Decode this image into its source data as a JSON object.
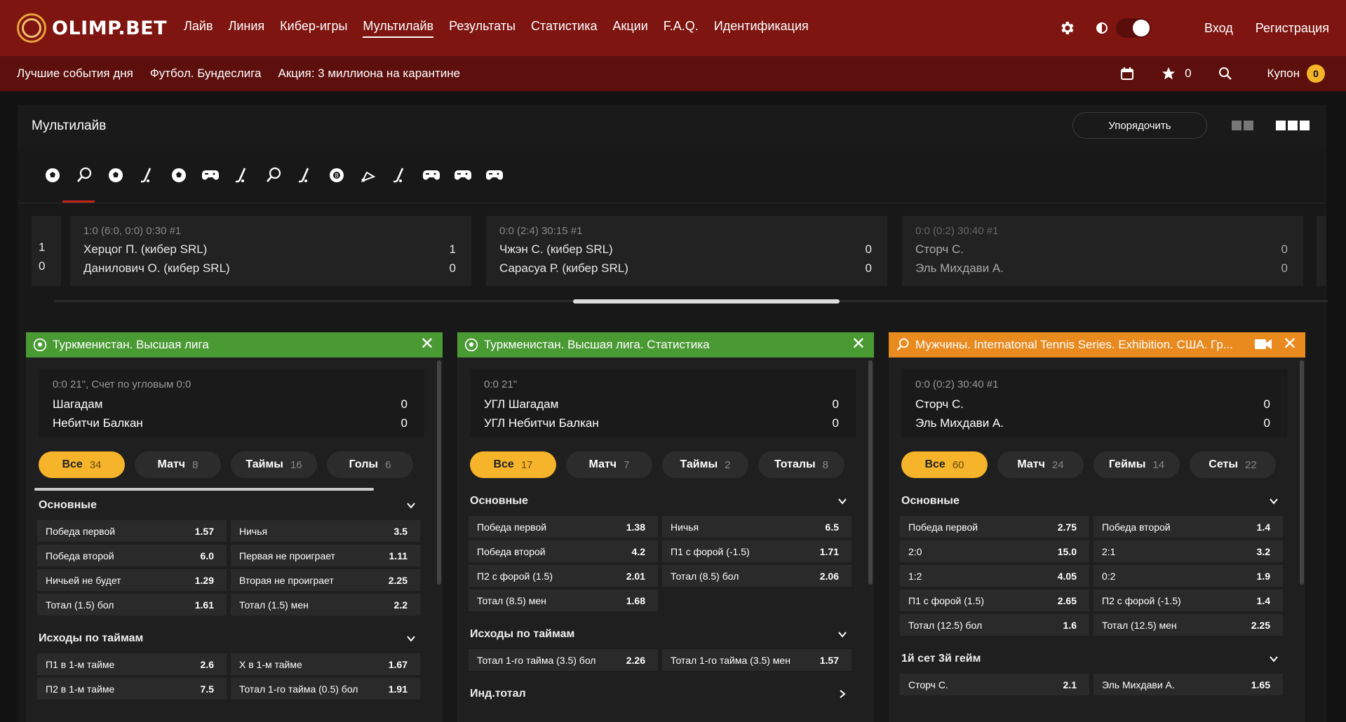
{
  "brand": {
    "name": "OLIMP.BET"
  },
  "nav": [
    "Лайв",
    "Линия",
    "Кибер-игры",
    "Мультилайв",
    "Результаты",
    "Статистика",
    "Акции",
    "F.A.Q.",
    "Идентификация"
  ],
  "header_right": {
    "login": "Вход",
    "register": "Регистрация"
  },
  "subnav": [
    "Лучшие события дня",
    "Футбол. Бундеслига",
    "Акция: 3 миллиона на карантине"
  ],
  "sub_right": {
    "favorites_count": "0",
    "coupon_label": "Купон",
    "coupon_count": "0"
  },
  "page": {
    "title": "Мультилайв",
    "order_button": "Упорядочить"
  },
  "sports_icons": [
    "football-icon",
    "tennis-icon",
    "basketball-icon",
    "hockey-icon",
    "volleyball-icon",
    "esports-icon",
    "cricket-icon",
    "table-tennis-icon",
    "hockey-stick-icon",
    "billiards-icon",
    "badminton-icon",
    "bandy-icon",
    "gamepad-icon",
    "gamepad-icon",
    "gamepad-icon"
  ],
  "live_strip": [
    {
      "meta": "",
      "team1": "",
      "team2": "",
      "score1": "1",
      "score2": "0"
    },
    {
      "meta": "1:0 (6:0, 0:0) 0:30 #1",
      "team1": "Херцог П. (кибер SRL)",
      "team2": "Данилович О. (кибер SRL)",
      "score1": "1",
      "score2": "0"
    },
    {
      "meta": "0:0 (2:4) 30:15 #1",
      "team1": "Чжэн С. (кибер SRL)",
      "team2": "Сарасуа Р. (кибер SRL)",
      "score1": "0",
      "score2": "0"
    },
    {
      "meta": "0:0 (0:2) 30:40 #1",
      "team1": "Сторч С.",
      "team2": "Эль Михдави А.",
      "score1": "0",
      "score2": "0"
    }
  ],
  "widgets": [
    {
      "title": "Туркменистан. Высшая лига",
      "meta": "0:0 21\", Счет по угловым 0:0",
      "team1": "Шагадам",
      "team2": "Небитчи Балкан",
      "score1": "0",
      "score2": "0",
      "tabs": [
        {
          "label": "Все",
          "count": "34"
        },
        {
          "label": "Матч",
          "count": "8"
        },
        {
          "label": "Таймы",
          "count": "16"
        },
        {
          "label": "Голы",
          "count": "6"
        }
      ],
      "sections": [
        {
          "title": "Основные",
          "rows": [
            [
              {
                "l": "Победа первой",
                "v": "1.57"
              },
              {
                "l": "Ничья",
                "v": "3.5"
              }
            ],
            [
              {
                "l": "Победа второй",
                "v": "6.0"
              },
              {
                "l": "Первая не проиграет",
                "v": "1.11"
              }
            ],
            [
              {
                "l": "Ничьей не будет",
                "v": "1.29"
              },
              {
                "l": "Вторая не проиграет",
                "v": "2.25"
              }
            ],
            [
              {
                "l": "Тотал (1.5) бол",
                "v": "1.61"
              },
              {
                "l": "Тотал (1.5) мен",
                "v": "2.2"
              }
            ]
          ]
        },
        {
          "title": "Исходы по таймам",
          "rows": [
            [
              {
                "l": "П1 в 1-м тайме",
                "v": "2.6"
              },
              {
                "l": "Х в 1-м тайме",
                "v": "1.67"
              }
            ],
            [
              {
                "l": "П2 в 1-м тайме",
                "v": "7.5"
              },
              {
                "l": "Тотал 1-го тайма (0.5) бол",
                "v": "1.91"
              }
            ]
          ]
        }
      ]
    },
    {
      "title": "Туркменистан. Высшая лига. Статистика",
      "meta": "0:0 21\"",
      "team1": "УГЛ Шагадам",
      "team2": "УГЛ Небитчи Балкан",
      "score1": "0",
      "score2": "0",
      "tabs": [
        {
          "label": "Все",
          "count": "17"
        },
        {
          "label": "Матч",
          "count": "7"
        },
        {
          "label": "Таймы",
          "count": "2"
        },
        {
          "label": "Тоталы",
          "count": "8"
        }
      ],
      "sections": [
        {
          "title": "Основные",
          "rows": [
            [
              {
                "l": "Победа первой",
                "v": "1.38"
              },
              {
                "l": "Ничья",
                "v": "6.5"
              }
            ],
            [
              {
                "l": "Победа второй",
                "v": "4.2"
              },
              {
                "l": "П1 с форой (-1.5)",
                "v": "1.71"
              }
            ],
            [
              {
                "l": "П2 с форой (1.5)",
                "v": "2.01"
              },
              {
                "l": "Тотал (8.5) бол",
                "v": "2.06"
              }
            ],
            [
              {
                "l": "Тотал (8.5) мен",
                "v": "1.68"
              },
              null
            ]
          ]
        },
        {
          "title": "Исходы по таймам",
          "rows": [
            [
              {
                "l": "Тотал 1-го тайма (3.5) бол",
                "v": "2.26"
              },
              {
                "l": "Тотал 1-го тайма (3.5) мен",
                "v": "1.57"
              }
            ]
          ]
        },
        {
          "title": "Инд.тотал",
          "rows": []
        }
      ]
    },
    {
      "title": "Мужчины. Internatonal Tennis Series. Exhibition. США. Гр...",
      "meta": "0:0 (0:2) 30:40 #1",
      "team1": "Сторч С.",
      "team2": "Эль Михдави А.",
      "score1": "0",
      "score2": "0",
      "tabs": [
        {
          "label": "Все",
          "count": "60"
        },
        {
          "label": "Матч",
          "count": "24"
        },
        {
          "label": "Геймы",
          "count": "14"
        },
        {
          "label": "Сеты",
          "count": "22"
        }
      ],
      "sections": [
        {
          "title": "Основные",
          "rows": [
            [
              {
                "l": "Победа первой",
                "v": "2.75"
              },
              {
                "l": "Победа второй",
                "v": "1.4"
              }
            ],
            [
              {
                "l": "2:0",
                "v": "15.0"
              },
              {
                "l": "2:1",
                "v": "3.2"
              }
            ],
            [
              {
                "l": "1:2",
                "v": "4.05"
              },
              {
                "l": "0:2",
                "v": "1.9"
              }
            ],
            [
              {
                "l": "П1 с форой (1.5)",
                "v": "2.65"
              },
              {
                "l": "П2 с форой (-1.5)",
                "v": "1.4"
              }
            ],
            [
              {
                "l": "Тотал (12.5) бол",
                "v": "1.6"
              },
              {
                "l": "Тотал (12.5) мен",
                "v": "2.25"
              }
            ]
          ]
        },
        {
          "title": "1й сет 3й гейм",
          "rows": [
            [
              {
                "l": "Сторч С.",
                "v": "2.1"
              },
              {
                "l": "Эль Михдави А.",
                "v": "1.65"
              }
            ]
          ]
        }
      ]
    }
  ],
  "colors": {
    "nav_bg": "#7e1511",
    "subnav_bg": "#5c0f0c",
    "accent": "#f6b42a",
    "football_header": "#4a9a34",
    "tennis_header": "#e98a1f"
  }
}
